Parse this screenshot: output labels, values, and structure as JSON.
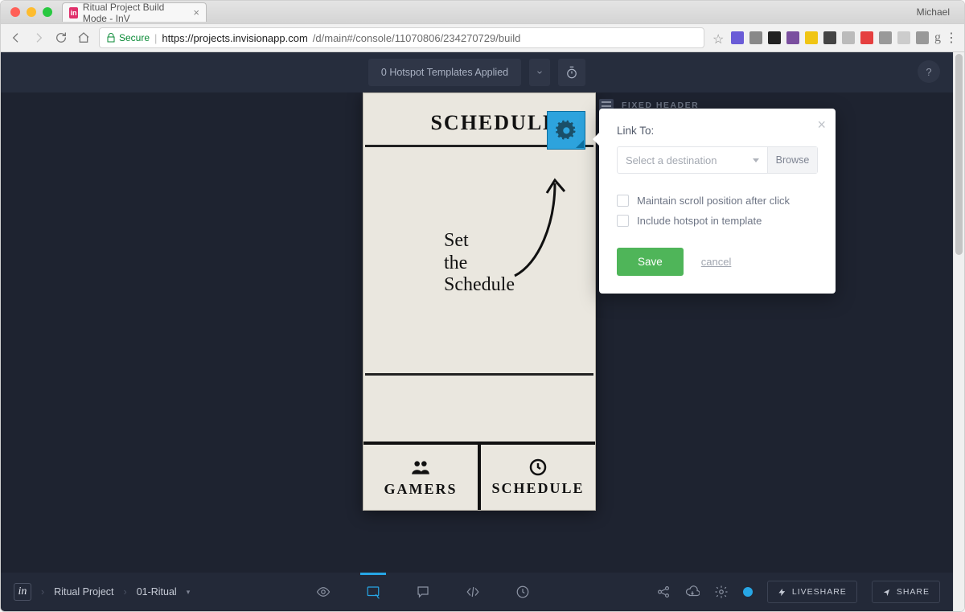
{
  "browser": {
    "tab_title": "Ritual Project Build Mode - InV",
    "profile": "Michael",
    "secure_label": "Secure",
    "url_host": "https://projects.invisionapp.com",
    "url_path": "/d/main#/console/11070806/234270729/build"
  },
  "topbar": {
    "hotspot_text": "0 Hotspot Templates Applied",
    "help": "?"
  },
  "fixed_header_label": "FIXED HEADER",
  "mockup": {
    "title": "SCHEDULE",
    "body_l1": "Set",
    "body_l2": "the",
    "body_l3": "Schedule",
    "foot_left": "GAMERS",
    "foot_right": "SCHEDULE"
  },
  "popover": {
    "link_to": "Link To:",
    "destination_placeholder": "Select a destination",
    "browse": "Browse",
    "check1": "Maintain scroll position after click",
    "check2": "Include hotspot in template",
    "save": "Save",
    "cancel": "cancel"
  },
  "bottom": {
    "project": "Ritual Project",
    "screen": "01-Ritual",
    "liveshare": "LIVESHARE",
    "share": "SHARE"
  }
}
